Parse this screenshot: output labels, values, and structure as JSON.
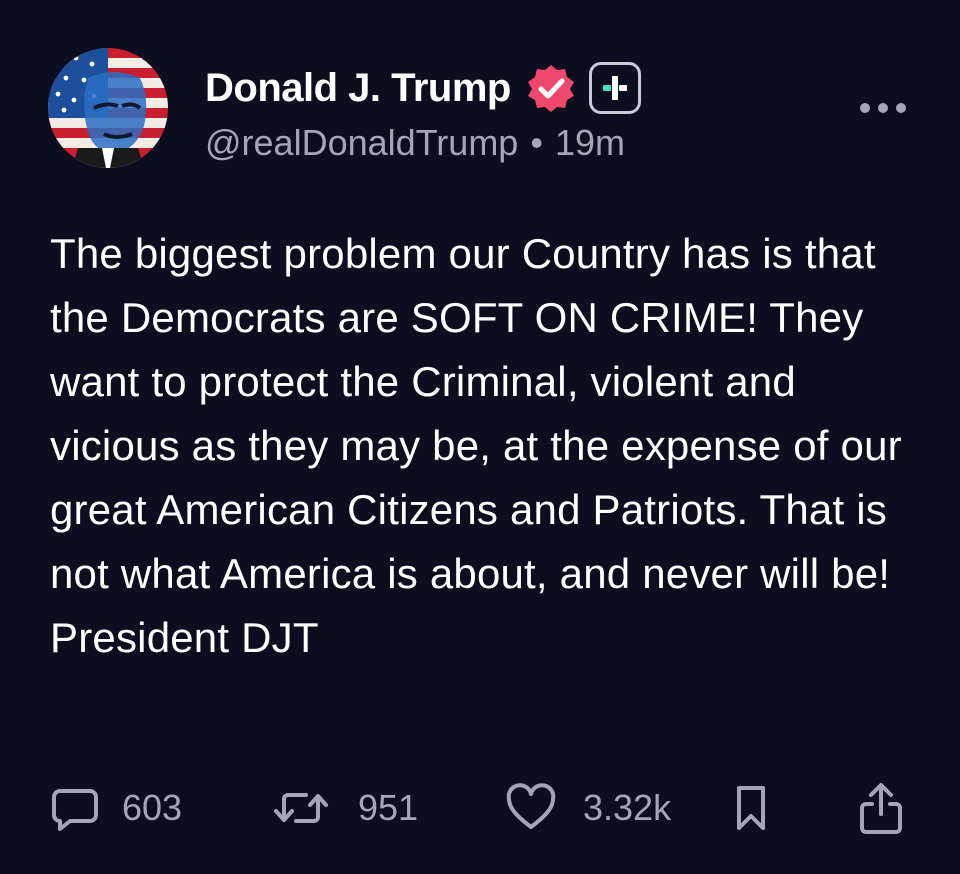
{
  "post": {
    "author": {
      "display_name": "Donald J. Trump",
      "handle": "@realDonaldTrump",
      "time": "19m",
      "separator": "•"
    },
    "text": "The biggest problem our Country has is that the Democrats are SOFT ON CRIME! They want to protect the Criminal, violent and vicious as they may be, at the expense of our great American Citizens and Patriots. That is not what America is about, and never will be! President DJT",
    "actions": {
      "replies": "603",
      "reposts": "951",
      "likes": "3.32k"
    }
  },
  "icons": {
    "avatar": "avatar-flag-portrait",
    "verified": "verified-badge-icon",
    "plus": "plus-badge-icon",
    "more": "more-icon",
    "reply": "comment-icon",
    "repost": "repost-icon",
    "like": "heart-icon",
    "bookmark": "bookmark-icon",
    "share": "share-icon"
  },
  "colors": {
    "background": "#0c0d1e",
    "text": "#ffffff",
    "muted": "#a3a6b4",
    "verified": "#f0486d",
    "plus_accent": "#3ee0c0"
  }
}
